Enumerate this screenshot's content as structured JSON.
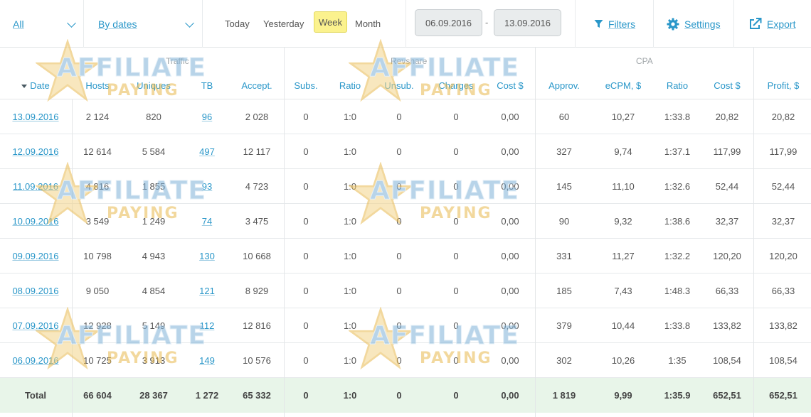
{
  "filters": {
    "scope_select": "All",
    "range_select": "By dates",
    "periods": [
      "Today",
      "Yesterday",
      "Week",
      "Month"
    ],
    "active_period": "Week",
    "date_from": "06.09.2016",
    "date_separator": "-",
    "date_to": "13.09.2016",
    "filters_label": "Filters",
    "settings_label": "Settings",
    "export_label": "Export"
  },
  "groups": {
    "traffic": "Traffic",
    "revshare": "Revshare",
    "cpa": "CPA"
  },
  "columns": [
    "Date",
    "Hosts",
    "Uniques",
    "TB",
    "Accept.",
    "Subs.",
    "Ratio",
    "Unsub.",
    "Charges",
    "Cost $",
    "Approv.",
    "eCPM, $",
    "Ratio",
    "Cost $",
    "Profit, $"
  ],
  "rows": [
    [
      "13.09.2016",
      "2 124",
      "820",
      "96",
      "2 028",
      "0",
      "1:0",
      "0",
      "0",
      "0,00",
      "60",
      "10,27",
      "1:33.8",
      "20,82",
      "20,82"
    ],
    [
      "12.09.2016",
      "12 614",
      "5 584",
      "497",
      "12 117",
      "0",
      "1:0",
      "0",
      "0",
      "0,00",
      "327",
      "9,74",
      "1:37.1",
      "117,99",
      "117,99"
    ],
    [
      "11.09.2016",
      "4 816",
      "1 855",
      "93",
      "4 723",
      "0",
      "1:0",
      "0",
      "0",
      "0,00",
      "145",
      "11,10",
      "1:32.6",
      "52,44",
      "52,44"
    ],
    [
      "10.09.2016",
      "3 549",
      "1 249",
      "74",
      "3 475",
      "0",
      "1:0",
      "0",
      "0",
      "0,00",
      "90",
      "9,32",
      "1:38.6",
      "32,37",
      "32,37"
    ],
    [
      "09.09.2016",
      "10 798",
      "4 943",
      "130",
      "10 668",
      "0",
      "1:0",
      "0",
      "0",
      "0,00",
      "331",
      "11,27",
      "1:32.2",
      "120,20",
      "120,20"
    ],
    [
      "08.09.2016",
      "9 050",
      "4 854",
      "121",
      "8 929",
      "0",
      "1:0",
      "0",
      "0",
      "0,00",
      "185",
      "7,43",
      "1:48.3",
      "66,33",
      "66,33"
    ],
    [
      "07.09.2016",
      "12 928",
      "5 149",
      "112",
      "12 816",
      "0",
      "1:0",
      "0",
      "0",
      "0,00",
      "379",
      "10,44",
      "1:33.8",
      "133,82",
      "133,82"
    ],
    [
      "06.09.2016",
      "10 725",
      "3 913",
      "149",
      "10 576",
      "0",
      "1:0",
      "0",
      "0",
      "0,00",
      "302",
      "10,26",
      "1:35",
      "108,54",
      "108,54"
    ]
  ],
  "total": [
    "Total",
    "66 604",
    "28 367",
    "1 272",
    "65 332",
    "0",
    "1:0",
    "0",
    "0",
    "0,00",
    "1 819",
    "9,99",
    "1:35.9",
    "652,51",
    "652,51"
  ],
  "watermark": {
    "line1": "AFFILIATE",
    "line2": "PAYING"
  },
  "colors": {
    "link": "#2a97c9",
    "active_period_bg": "#fbf28e",
    "total_row_bg": "#e8f5e9",
    "group_label": "#a0a6a9"
  }
}
